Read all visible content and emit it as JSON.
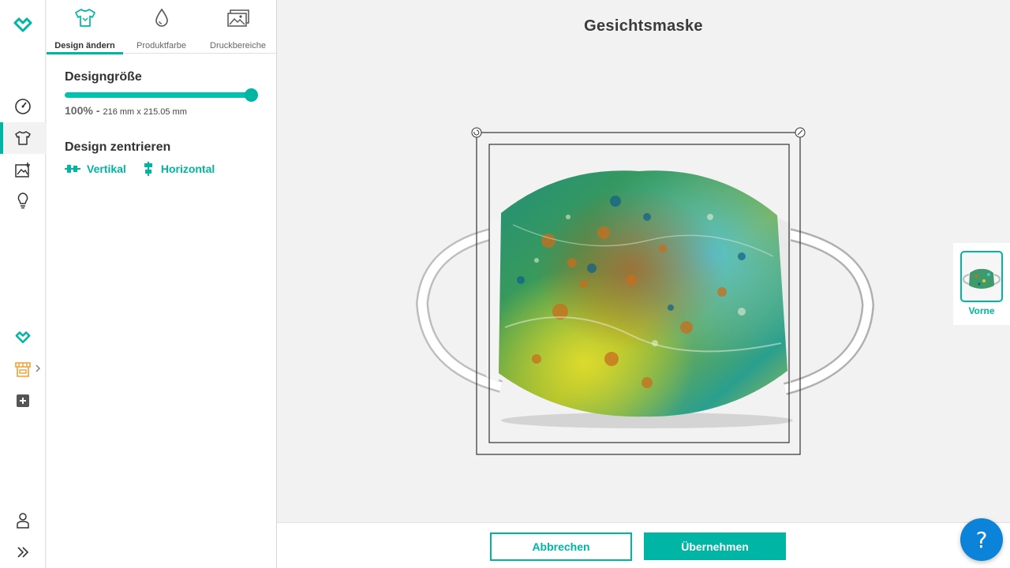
{
  "theme": {
    "accent": "#00b5a3",
    "help_blue": "#0a83d8"
  },
  "rail": {
    "items": [
      {
        "name": "logo-icon"
      },
      {
        "name": "dashboard-icon"
      },
      {
        "name": "shirt-icon",
        "active": true
      },
      {
        "name": "image-upload-icon"
      },
      {
        "name": "lightbulb-icon"
      },
      {
        "name": "brand-icon"
      },
      {
        "name": "shop-icon"
      },
      {
        "name": "add-icon"
      },
      {
        "name": "user-icon"
      },
      {
        "name": "expand-icon"
      }
    ]
  },
  "tabs": [
    {
      "label": "Design ändern",
      "icon": "shirt-icon",
      "active": true
    },
    {
      "label": "Produktfarbe",
      "icon": "drop-icon",
      "active": false
    },
    {
      "label": "Druckbereiche",
      "icon": "images-icon",
      "active": false
    }
  ],
  "design_size": {
    "title": "Designgröße",
    "percent_label": "100%",
    "separator": "-",
    "dimensions": "216 mm x 215.05 mm",
    "slider_value": 1.0
  },
  "centering": {
    "title": "Design zentrieren",
    "vertical_label": "Vertikal",
    "horizontal_label": "Horizontal"
  },
  "product": {
    "title": "Gesichtsmaske"
  },
  "views": [
    {
      "label": "Vorne",
      "selected": true
    }
  ],
  "actions": {
    "cancel_label": "Abbrechen",
    "apply_label": "Übernehmen"
  },
  "help": {
    "label": "?"
  }
}
